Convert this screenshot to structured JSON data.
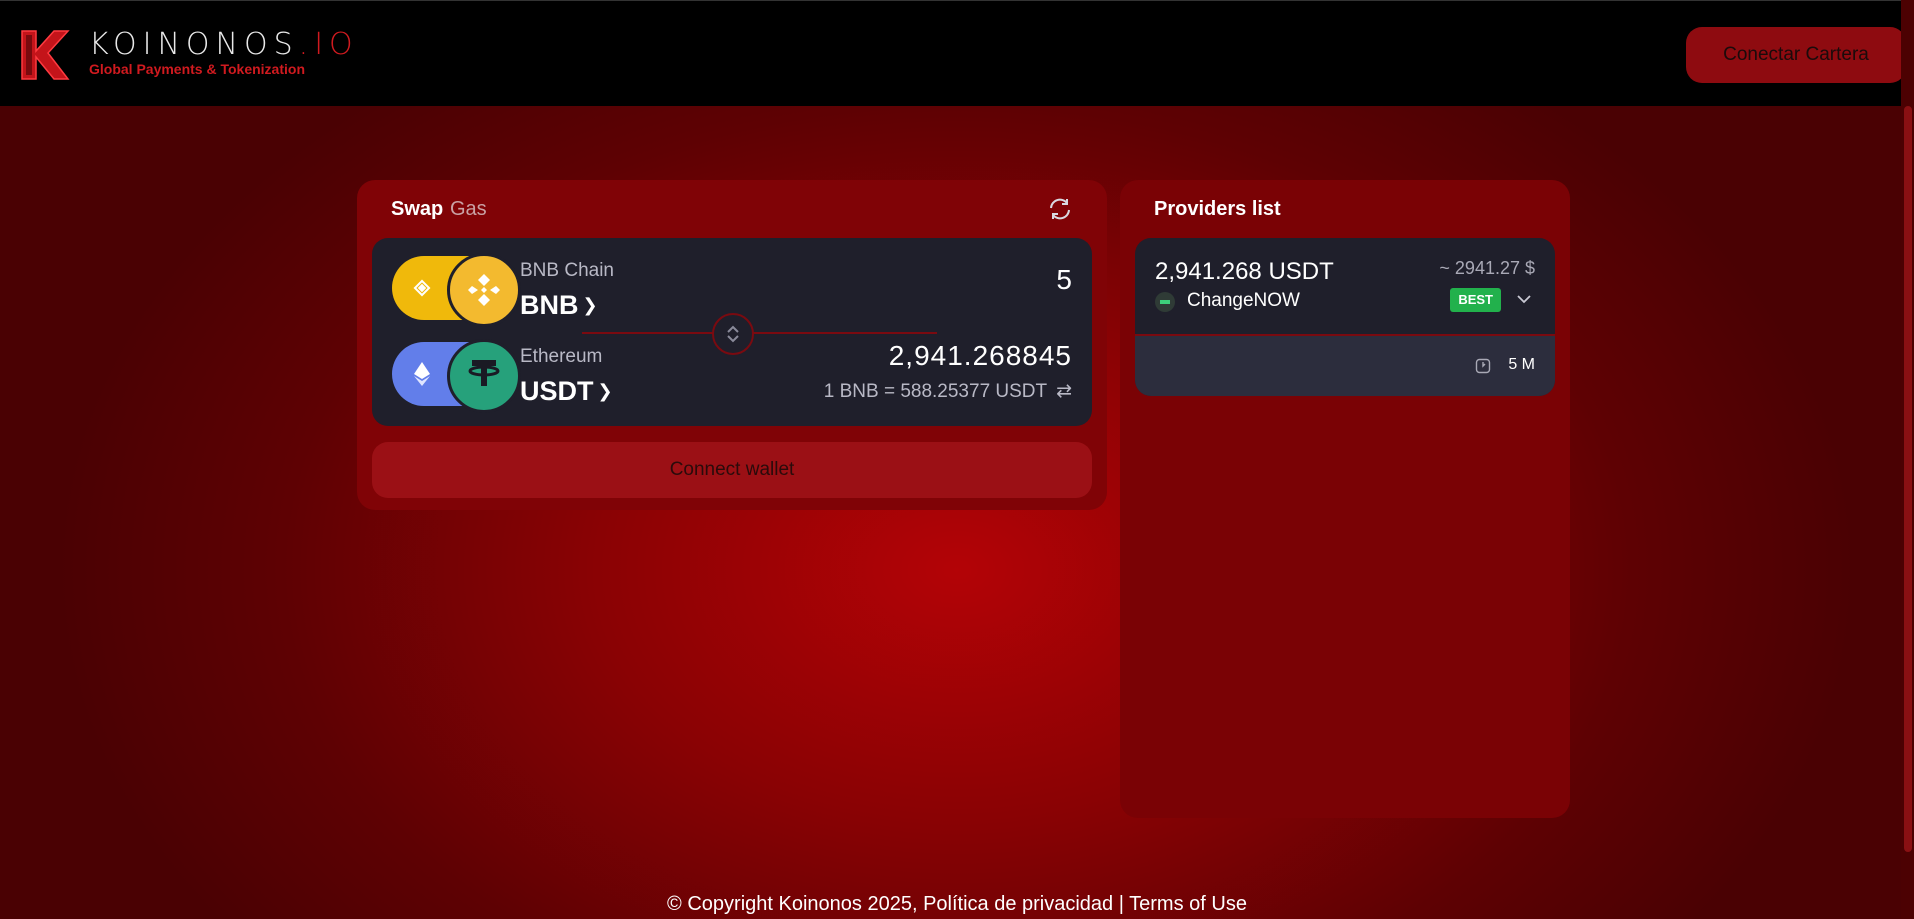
{
  "header": {
    "brand_main": "KOINONOS",
    "brand_suffix": ".IO",
    "tagline": "Global Payments & Tokenization",
    "connect_label": "Conectar Cartera"
  },
  "swap": {
    "tab_swap": "Swap",
    "tab_gas": "Gas",
    "from": {
      "chain": "BNB Chain",
      "token": "BNB",
      "amount": "5"
    },
    "to": {
      "chain": "Ethereum",
      "token": "USDT",
      "amount": "2,941.268845",
      "rate": "1 BNB = 588.25377 USDT"
    },
    "connect_wallet_label": "Connect wallet"
  },
  "providers": {
    "title": "Providers list",
    "items": [
      {
        "amount": "2,941.268 USDT",
        "usd": "~ 2941.27 $",
        "name": "ChangeNOW",
        "badge": "BEST",
        "time": "5 M"
      }
    ]
  },
  "footer": {
    "copyright": "© Copyright Koinonos 2025,",
    "privacy": "Política de privacidad",
    "separator": "|",
    "terms": "Terms of Use"
  },
  "colors": {
    "accent": "#d01a1f",
    "button": "#8e0b10",
    "panel": "#1f1f2b",
    "best": "#22b14c"
  },
  "icons": [
    "koinonos-logo-icon",
    "refresh-icon",
    "bnb-icon",
    "ethereum-icon",
    "tether-icon",
    "swap-direction-icon",
    "exchange-rate-icon",
    "changenow-icon",
    "chevron-down-icon",
    "clock-icon"
  ]
}
